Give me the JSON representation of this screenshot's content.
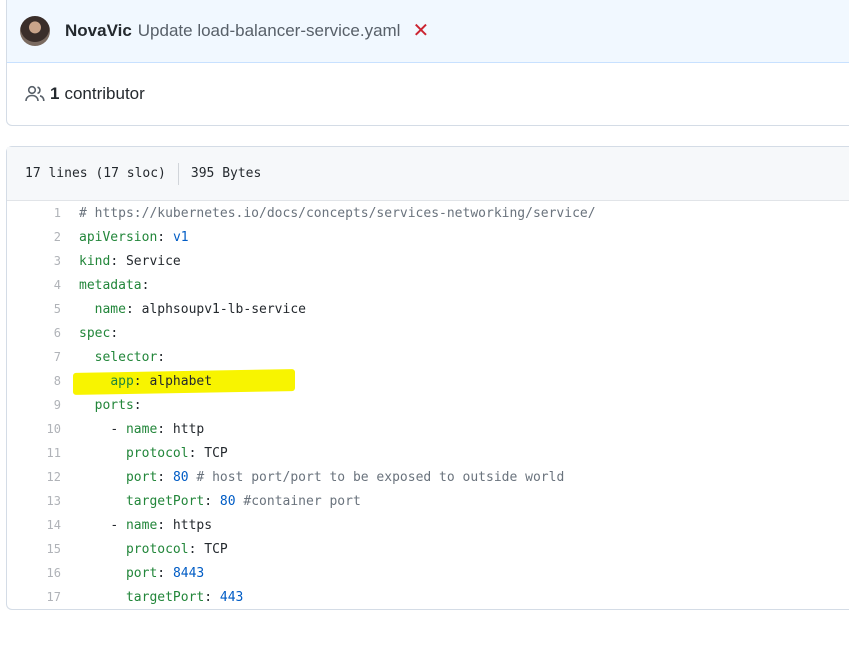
{
  "commit": {
    "author": "NovaVic",
    "message": "Update load-balancer-service.yaml",
    "status_icon": "x-icon",
    "contributors_count": "1",
    "contributors_label": "contributor"
  },
  "file": {
    "lines_info": "17 lines (17 sloc)",
    "size": "395 Bytes",
    "highlight_color": "#f8f400",
    "lines": [
      {
        "n": "1",
        "indent": "",
        "parts": [
          {
            "t": "# https://kubernetes.io/docs/concepts/services-networking/service/",
            "c": "c"
          }
        ]
      },
      {
        "n": "2",
        "indent": "",
        "parts": [
          {
            "t": "apiVersion",
            "c": "k"
          },
          {
            "t": ": ",
            "c": ""
          },
          {
            "t": "v1",
            "c": "n"
          }
        ]
      },
      {
        "n": "3",
        "indent": "",
        "parts": [
          {
            "t": "kind",
            "c": "k"
          },
          {
            "t": ": Service",
            "c": ""
          }
        ]
      },
      {
        "n": "4",
        "indent": "",
        "parts": [
          {
            "t": "metadata",
            "c": "k"
          },
          {
            "t": ":",
            "c": ""
          }
        ]
      },
      {
        "n": "5",
        "indent": "  ",
        "parts": [
          {
            "t": "name",
            "c": "k"
          },
          {
            "t": ": alphsoupv1-lb-service",
            "c": ""
          }
        ]
      },
      {
        "n": "6",
        "indent": "",
        "parts": [
          {
            "t": "spec",
            "c": "k"
          },
          {
            "t": ":",
            "c": ""
          }
        ]
      },
      {
        "n": "7",
        "indent": "  ",
        "parts": [
          {
            "t": "selector",
            "c": "k"
          },
          {
            "t": ":",
            "c": ""
          }
        ]
      },
      {
        "n": "8",
        "indent": "    ",
        "parts": [
          {
            "t": "app",
            "c": "k"
          },
          {
            "t": ": alphabet",
            "c": ""
          }
        ]
      },
      {
        "n": "9",
        "indent": "  ",
        "parts": [
          {
            "t": "ports",
            "c": "k"
          },
          {
            "t": ":",
            "c": ""
          }
        ]
      },
      {
        "n": "10",
        "indent": "    ",
        "parts": [
          {
            "t": "- ",
            "c": ""
          },
          {
            "t": "name",
            "c": "k"
          },
          {
            "t": ": http",
            "c": ""
          }
        ]
      },
      {
        "n": "11",
        "indent": "      ",
        "parts": [
          {
            "t": "protocol",
            "c": "k"
          },
          {
            "t": ": TCP",
            "c": ""
          }
        ]
      },
      {
        "n": "12",
        "indent": "      ",
        "parts": [
          {
            "t": "port",
            "c": "k"
          },
          {
            "t": ": ",
            "c": ""
          },
          {
            "t": "80",
            "c": "n"
          },
          {
            "t": " # host port/port to be exposed to outside world",
            "c": "c"
          }
        ]
      },
      {
        "n": "13",
        "indent": "      ",
        "parts": [
          {
            "t": "targetPort",
            "c": "k"
          },
          {
            "t": ": ",
            "c": ""
          },
          {
            "t": "80",
            "c": "n"
          },
          {
            "t": " #container port",
            "c": "c"
          }
        ]
      },
      {
        "n": "14",
        "indent": "    ",
        "parts": [
          {
            "t": "- ",
            "c": ""
          },
          {
            "t": "name",
            "c": "k"
          },
          {
            "t": ": https",
            "c": ""
          }
        ]
      },
      {
        "n": "15",
        "indent": "      ",
        "parts": [
          {
            "t": "protocol",
            "c": "k"
          },
          {
            "t": ": TCP",
            "c": ""
          }
        ]
      },
      {
        "n": "16",
        "indent": "      ",
        "parts": [
          {
            "t": "port",
            "c": "k"
          },
          {
            "t": ": ",
            "c": ""
          },
          {
            "t": "8443",
            "c": "n"
          }
        ]
      },
      {
        "n": "17",
        "indent": "      ",
        "parts": [
          {
            "t": "targetPort",
            "c": "k"
          },
          {
            "t": ": ",
            "c": ""
          },
          {
            "t": "443",
            "c": "n"
          }
        ]
      }
    ]
  }
}
